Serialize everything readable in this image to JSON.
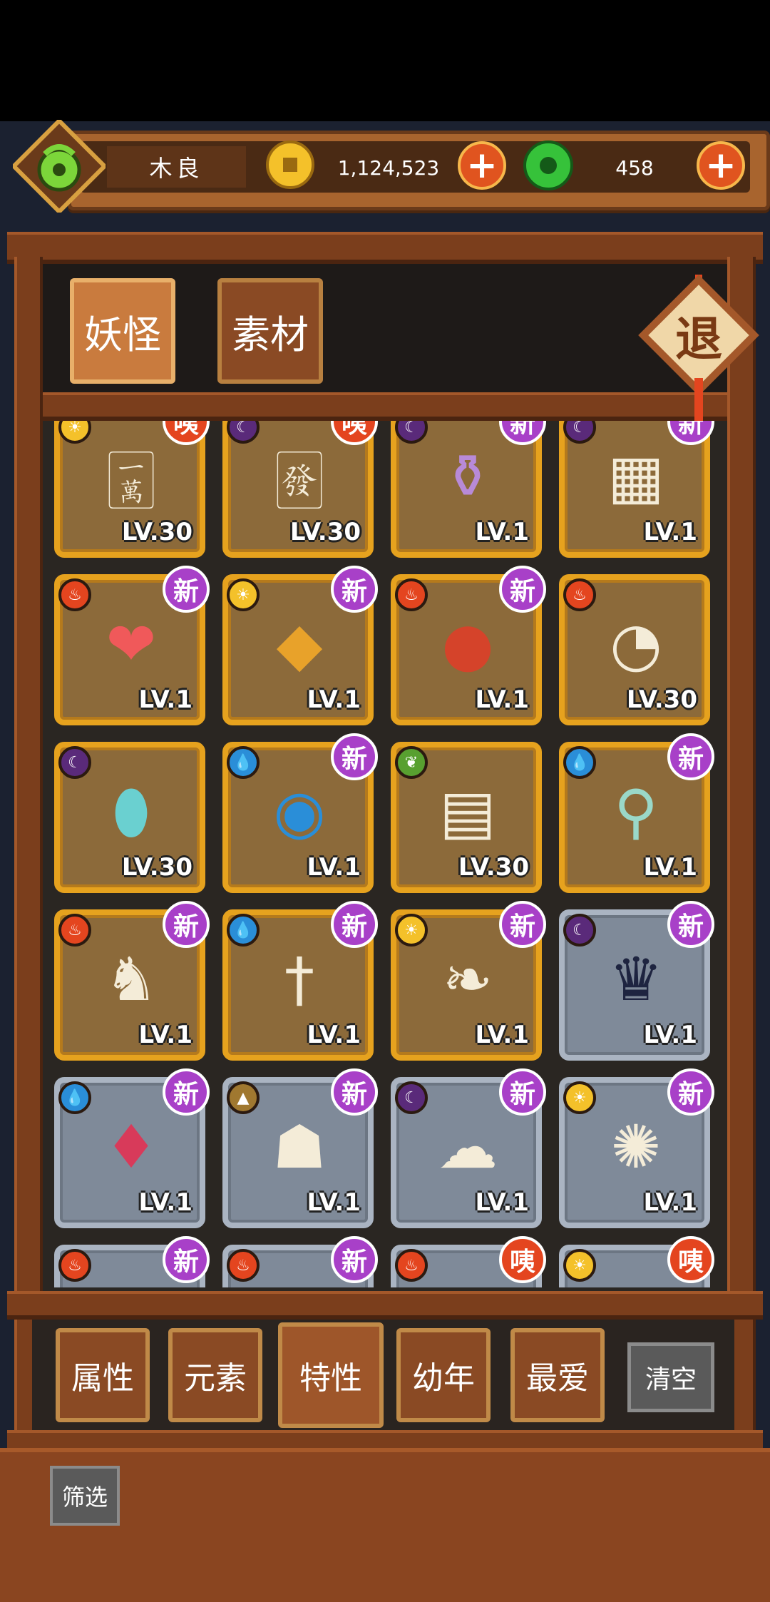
{
  "player": {
    "name": "木良"
  },
  "currency": {
    "coins": "1,124,523",
    "jade": "458",
    "plus": "+"
  },
  "tabs": [
    {
      "label": "妖怪"
    },
    {
      "label": "素材"
    }
  ],
  "exit_label": "退",
  "filters": [
    {
      "label": "属性"
    },
    {
      "label": "元素"
    },
    {
      "label": "特性"
    },
    {
      "label": "幼年"
    },
    {
      "label": "最爱"
    }
  ],
  "clear_label": "清空",
  "sift_label": "筛选",
  "badges": {
    "new": "新",
    "odd": "咦"
  },
  "cards": [
    {
      "level": "LV.30",
      "frame": "gold",
      "element": "sun",
      "badge": "odd",
      "art": "mahjong-eight-bamboo-icon"
    },
    {
      "level": "LV.30",
      "frame": "gold",
      "element": "moon",
      "badge": "odd",
      "art": "mahjong-six-bamboo-icon"
    },
    {
      "level": "LV.1",
      "frame": "gold",
      "element": "moon",
      "badge": "new",
      "art": "purple-spirit-cauldron-icon"
    },
    {
      "level": "LV.1",
      "frame": "gold",
      "element": "moon",
      "badge": "new",
      "art": "wooden-frame-creature-icon"
    },
    {
      "level": "LV.1",
      "frame": "gold",
      "element": "fire",
      "badge": "new",
      "art": "red-heart-creature-icon"
    },
    {
      "level": "LV.1",
      "frame": "gold",
      "element": "sun",
      "badge": "new",
      "art": "golden-rock-creature-icon"
    },
    {
      "level": "LV.1",
      "frame": "gold",
      "element": "fire",
      "badge": "new",
      "art": "red-ball-creature-icon"
    },
    {
      "level": "LV.30",
      "frame": "gold",
      "element": "fire",
      "badge": "none",
      "art": "sperm-spirit-icon"
    },
    {
      "level": "LV.30",
      "frame": "gold",
      "element": "moon",
      "badge": "none",
      "art": "teal-egg-creature-icon"
    },
    {
      "level": "LV.1",
      "frame": "gold",
      "element": "water",
      "badge": "new",
      "art": "blue-water-blob-icon"
    },
    {
      "level": "LV.30",
      "frame": "gold",
      "element": "wood",
      "badge": "none",
      "art": "log-spirit-icon"
    },
    {
      "level": "LV.1",
      "frame": "gold",
      "element": "water",
      "badge": "new",
      "art": "vase-branch-icon"
    },
    {
      "level": "LV.1",
      "frame": "gold",
      "element": "fire",
      "badge": "new",
      "art": "calico-cat-icon"
    },
    {
      "level": "LV.1",
      "frame": "gold",
      "element": "water",
      "badge": "new",
      "art": "sword-crow-icon"
    },
    {
      "level": "LV.1",
      "frame": "gold",
      "element": "sun",
      "badge": "new",
      "art": "white-feather-icon"
    },
    {
      "level": "LV.1",
      "frame": "silver",
      "element": "moon",
      "badge": "new",
      "art": "chess-queen-icon"
    },
    {
      "level": "LV.1",
      "frame": "silver",
      "element": "water",
      "badge": "new",
      "art": "diamond-card-icon"
    },
    {
      "level": "LV.1",
      "frame": "silver",
      "element": "earth",
      "badge": "new",
      "art": "hooded-doll-icon"
    },
    {
      "level": "LV.1",
      "frame": "silver",
      "element": "moon",
      "badge": "new",
      "art": "bone-ghost-icon"
    },
    {
      "level": "LV.1",
      "frame": "silver",
      "element": "sun",
      "badge": "new",
      "art": "puffer-fish-icon"
    },
    {
      "level": "",
      "frame": "silver",
      "element": "fire",
      "badge": "new",
      "art": "red-creature-icon"
    },
    {
      "level": "",
      "frame": "silver",
      "element": "fire",
      "badge": "new",
      "art": "red-item-icon"
    },
    {
      "level": "",
      "frame": "silver",
      "element": "fire",
      "badge": "odd",
      "art": "white-tile-icon"
    },
    {
      "level": "",
      "frame": "silver",
      "element": "sun",
      "badge": "odd",
      "art": "white-tile-icon"
    }
  ],
  "colors": {
    "gold_frame": "#e6a21e",
    "silver_frame": "#aab4c2",
    "new_badge": "#a840c8",
    "odd_badge": "#e4451f"
  }
}
